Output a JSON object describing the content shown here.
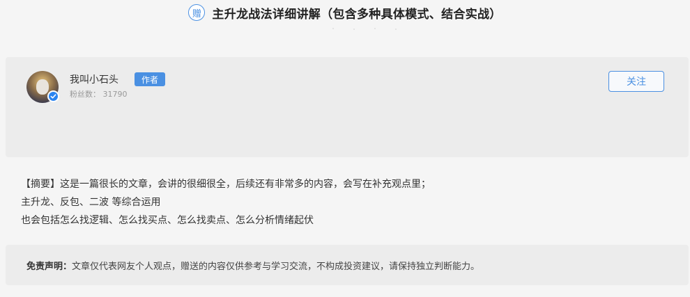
{
  "title": {
    "badge": "赠",
    "text": "主升龙战法详细讲解（包含多种具体模式、结合实战）"
  },
  "author": {
    "name": "我叫小石头",
    "tag": "作者",
    "fans": "粉丝数：  31790",
    "follow_label": "关注"
  },
  "summary": {
    "line1": "【摘要】这是一篇很长的文章，会讲的很细很全，后续还有非常多的内容，会写在补充观点里；",
    "line2": "主升龙、反包、二波 等综合运用",
    "line3": "也会包括怎么找逻辑、怎么找买点、怎么找卖点、怎么分析情绪起伏"
  },
  "disclaimer": {
    "label": "免责声明：",
    "text": "文章仅代表网友个人观点，赠送的内容仅供参考与学习交流，不构成投资建议，请保持独立判断能力。"
  },
  "colors": {
    "accent": "#4a90e2",
    "verified": "#2b84f0"
  }
}
